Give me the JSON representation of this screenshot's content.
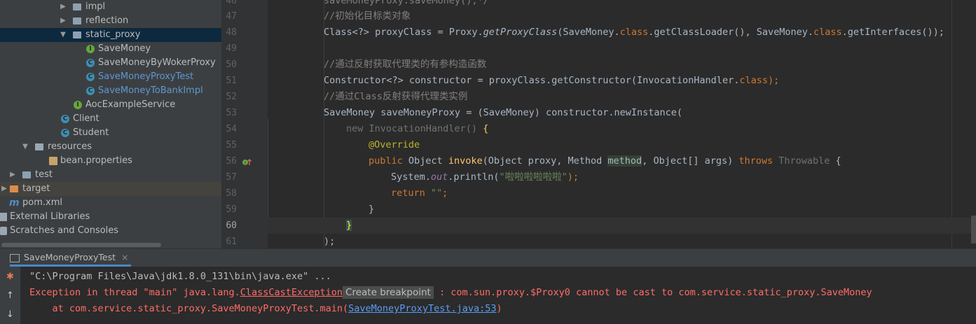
{
  "project_tree": {
    "items": [
      {
        "label": "impl",
        "type": "folder"
      },
      {
        "label": "reflection",
        "type": "folder"
      },
      {
        "label": "static_proxy",
        "type": "folder"
      },
      {
        "label": "SaveMoney",
        "type": "interface"
      },
      {
        "label": "SaveMoneyByWokerProxy",
        "type": "class"
      },
      {
        "label": "SaveMoneyProxyTest",
        "type": "class"
      },
      {
        "label": "SaveMoneyToBankImpl",
        "type": "class"
      },
      {
        "label": "AocExampleService",
        "type": "interface"
      },
      {
        "label": "Client",
        "type": "class"
      },
      {
        "label": "Student",
        "type": "class"
      },
      {
        "label": "resources",
        "type": "folder"
      },
      {
        "label": "bean.properties",
        "type": "properties"
      },
      {
        "label": "test",
        "type": "folder"
      },
      {
        "label": "target",
        "type": "folder-excluded"
      },
      {
        "label": "pom.xml",
        "type": "maven"
      },
      {
        "label": "External Libraries",
        "type": "libraries"
      },
      {
        "label": "Scratches and Consoles",
        "type": "scratches"
      }
    ]
  },
  "editor": {
    "line_numbers": [
      "46",
      "47",
      "48",
      "49",
      "50",
      "51",
      "52",
      "53",
      "54",
      "55",
      "56",
      "57",
      "58",
      "59",
      "60",
      "61"
    ],
    "current_line": "60",
    "code": {
      "l46": "saveMoneyProxy.saveMoney();*/",
      "l47": "//初始化目标类对象",
      "l48a": "Class<?> proxyClass = Proxy.",
      "l48b": "getProxyClass",
      "l48c": "(SaveMoney.",
      "l48d": "class",
      "l48e": ".getClassLoader(), SaveMoney.",
      "l48f": "class",
      "l48g": ".getInterfaces());",
      "l50": "//通过反射获取代理类的有参构造函数",
      "l51a": "Constructor<?> constructor = proxyClass.getConstructor(InvocationHandler.",
      "l51b": "class",
      "l51c": ");",
      "l52": "//通过Class反射获得代理类实例",
      "l53": "SaveMoney saveMoneyProxy = (SaveMoney) constructor.newInstance(",
      "l54a": "new",
      "l54b": " InvocationHandler() ",
      "l54c": "{",
      "l55": "@Override",
      "l56a": "public",
      "l56b": " Object ",
      "l56c": "invoke",
      "l56d": "(Object proxy, Method ",
      "l56e": "method",
      "l56f": ", Object[] args) ",
      "l56g": "throws",
      "l56h": " Throwable ",
      "l56i": "{",
      "l57a": "System.",
      "l57b": "out",
      "l57c": ".println(",
      "l57d": "\"啦啦啦啦啦啦\"",
      "l57e": ");",
      "l58a": "return",
      "l58b": " \"\"",
      "l58c": ";",
      "l59": "}",
      "l60": "}",
      "l61": ");"
    }
  },
  "run_panel": {
    "tab_label": "SaveMoneyProxyTest",
    "cmd_line": "\"C:\\Program Files\\Java\\jdk1.8.0_131\\bin\\java.exe\" ...",
    "exc_prefix": "Exception in thread \"main\" java.lang.",
    "exc_class": "ClassCastException",
    "tooltip": "Create breakpoint",
    "exc_message": " : com.sun.proxy.$Proxy0 cannot be cast to com.service.static_proxy.SaveMoney",
    "trace_prefix": "    at com.service.static_proxy.SaveMoneyProxyTest.main(",
    "trace_link": "SaveMoneyProxyTest.java:53",
    "trace_suffix": ")"
  },
  "colors": {
    "background": "#2b2b2b",
    "tree_background": "#3c3f41",
    "error_red": "#ff6b68",
    "keyword": "#cc7832",
    "comment": "#808080"
  }
}
